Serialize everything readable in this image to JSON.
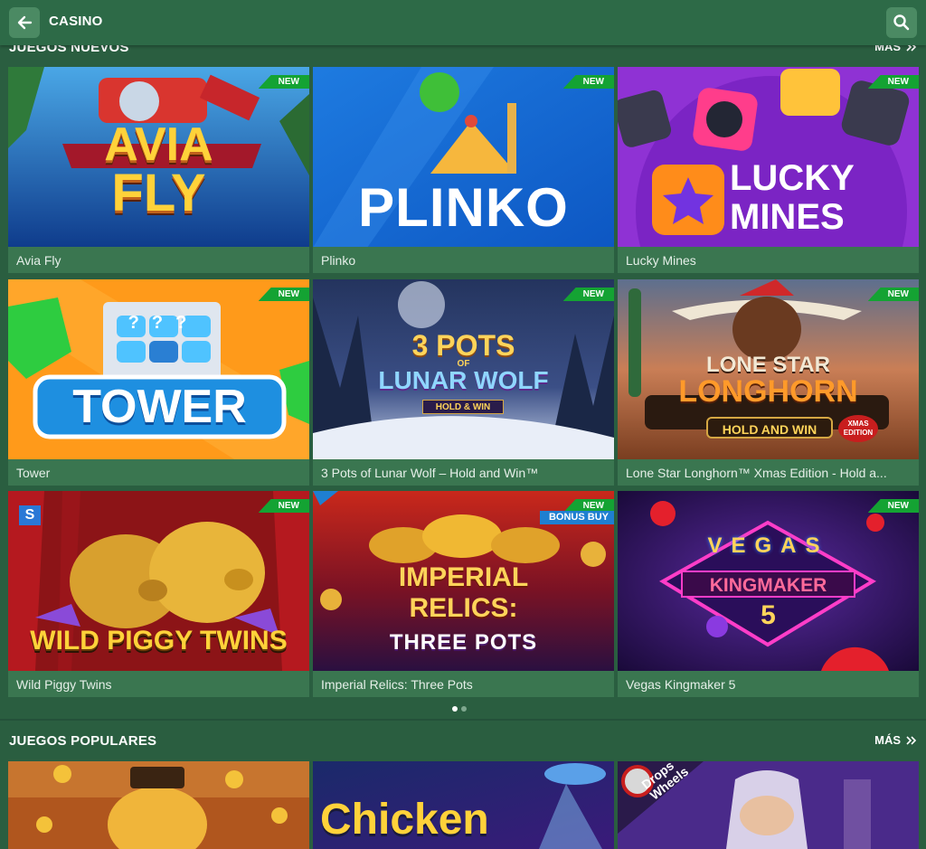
{
  "header": {
    "title": "CASINO",
    "back_icon": "arrow-left-icon",
    "search_icon": "search-icon"
  },
  "new_games": {
    "title": "JUEGOS NUEVOS",
    "more_label": "MÁS",
    "pagination": {
      "pages": 2,
      "current": 1
    },
    "games": [
      {
        "name": "Avia Fly",
        "badge": "NEW",
        "art_text": [
          "AVIA",
          "FLY"
        ]
      },
      {
        "name": "Plinko",
        "badge": "NEW",
        "art_text": [
          "PLINKO"
        ]
      },
      {
        "name": "Lucky Mines",
        "badge": "NEW",
        "art_text": [
          "LUCKY",
          "MINES"
        ]
      },
      {
        "name": "Tower",
        "badge": "NEW",
        "art_text": [
          "TOWER",
          "???"
        ]
      },
      {
        "name": "3 Pots of Lunar Wolf – Hold and Win™",
        "badge": "NEW",
        "art_text": [
          "3 POTS",
          "OF",
          "LUNAR WOLF",
          "HOLD & WIN"
        ]
      },
      {
        "name": "Lone Star Longhorn™ Xmas Edition - Hold a...",
        "badge": "NEW",
        "art_text": [
          "LONE STAR",
          "LONGHORN",
          "HOLD AND WIN",
          "XMAS EDITION"
        ]
      },
      {
        "name": "Wild Piggy Twins",
        "badge": "NEW",
        "art_text": [
          "WILD PIGGY TWINS"
        ]
      },
      {
        "name": "Imperial Relics: Three Pots",
        "badge": "NEW",
        "badge2": "BONUS BUY",
        "art_text": [
          "IMPERIAL",
          "RELICS:",
          "THREE POTS"
        ]
      },
      {
        "name": "Vegas Kingmaker 5",
        "badge": "NEW",
        "art_text": [
          "VEGAS",
          "KINGMAKER",
          "5"
        ]
      }
    ]
  },
  "popular_games": {
    "title": "JUEGOS POPULARES",
    "more_label": "MÁS",
    "games": [
      {
        "art_text": []
      },
      {
        "art_text": [
          "Chicken"
        ]
      },
      {
        "art_text": [
          "Drops",
          "Wheels"
        ]
      }
    ]
  },
  "colors": {
    "background": "#2a5e40",
    "header": "#2d6a47",
    "card": "#3a7650",
    "badge_new": "#14a333",
    "badge_bonus": "#1f7fd1"
  }
}
